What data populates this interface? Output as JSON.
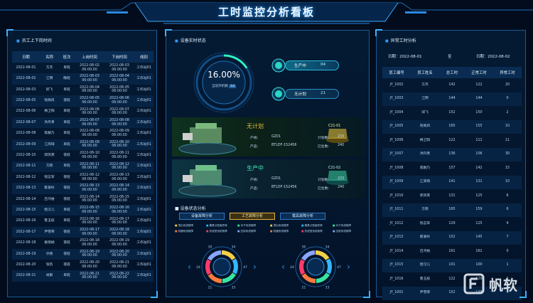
{
  "header": {
    "title": "工时监控分析看板"
  },
  "left": {
    "title": "员工上下岗时间",
    "columns": [
      "日期",
      "名称",
      "班次",
      "上岗时间",
      "下岗时间",
      "线别"
    ],
    "rows": [
      [
        "2022-08-01",
        "方杰",
        "早班",
        "2022-08-02 06:00:00",
        "2022-08-03 06:00:00",
        "工作站01"
      ],
      [
        "2022-08-02",
        "江明",
        "晚班",
        "2022-08-03 06:00:00",
        "2022-08-04 06:00:00",
        "工作站01"
      ],
      [
        "2022-08-03",
        "邱飞",
        "早班",
        "2022-08-04 06:00:00",
        "2022-08-05 06:00:00",
        "工作站01"
      ],
      [
        "2022-08-05",
        "钱佩凤",
        "夜班",
        "2022-08-05 06:00:00",
        "2022-08-06 06:00:00",
        "工作站01"
      ],
      [
        "2022-08-06",
        "梅卫阳",
        "早班",
        "2022-08-06 06:00:00",
        "2022-08-07 06:00:00",
        "工作站01"
      ],
      [
        "2022-08-07",
        "洪丹青",
        "早班",
        "2022-08-07 06:00:00",
        "2022-08-08 06:00:00",
        "工作站01"
      ],
      [
        "2022-08-08",
        "蒋群乃",
        "早班",
        "2022-08-08 06:00:00",
        "2022-08-09 06:00:00",
        "工作站01"
      ],
      [
        "2022-08-09",
        "江简琦",
        "早班",
        "2022-08-09 06:00:00",
        "2022-08-10 06:00:00",
        "工作站01"
      ],
      [
        "2022-08-10",
        "郭凤英",
        "夜班",
        "2022-08-10 06:00:00",
        "2022-08-11 06:00:00",
        "工作站01"
      ],
      [
        "2022-08-11",
        "方晓",
        "早班",
        "2022-08-11 06:00:00",
        "2022-08-12 06:00:00",
        "工作站01"
      ],
      [
        "2022-08-12",
        "钱志军",
        "夜班",
        "2022-08-12 06:00:00",
        "2022-08-13 06:00:00",
        "工作站01"
      ],
      [
        "2022-08-13",
        "蔡爱岭",
        "夜班",
        "2022-08-13 06:00:00",
        "2022-08-14 06:00:00",
        "工作站01"
      ],
      [
        "2022-08-14",
        "吕鸿裕",
        "夜班",
        "2022-08-14 06:00:00",
        "2022-08-15 06:00:00",
        "工作站01"
      ],
      [
        "2022-08-15",
        "程汉儿",
        "早班",
        "2022-08-15 06:00:00",
        "2022-08-16 06:00:00",
        "工作站01"
      ],
      [
        "2022-08-16",
        "鲁玉枝",
        "早班",
        "2022-08-16 06:00:00",
        "2022-08-17 06:00:00",
        "工作站01"
      ],
      [
        "2022-08-17",
        "尹雪荣",
        "夜班",
        "2022-08-17 06:00:00",
        "2022-08-18 06:00:00",
        "工作站01"
      ],
      [
        "2022-08-18",
        "秦丽娟",
        "夜班",
        "2022-08-18 06:00:00",
        "2022-08-19 06:00:00",
        "工作站01"
      ],
      [
        "2022-08-19",
        "许杨",
        "夜班",
        "2022-08-19 06:00:00",
        "2022-08-20 06:00:00",
        "工作站01"
      ],
      [
        "2022-08-20",
        "张凯",
        "夜班",
        "2022-08-20 06:00:00",
        "2022-08-21 06:00:00",
        "工作站01"
      ],
      [
        "2022-08-21",
        "尚毅",
        "早班",
        "2022-08-21 06:00:00",
        "2022-08-22 06:00:00",
        "工作站01"
      ]
    ]
  },
  "middle": {
    "title": "设备实时状态",
    "gauge": {
      "value": "16.00%",
      "label": "当前开机数",
      "count": "04",
      "fraction": 0.16
    },
    "pill1": {
      "label": "生产中",
      "value": "04"
    },
    "pill2": {
      "label": "无计划",
      "value": "21"
    },
    "devices": [
      {
        "status": "无计划",
        "code": "C21-01",
        "k1": "产线:",
        "v1": "GZ01",
        "k2": "计划数:",
        "v2": "233",
        "k3": "产品:",
        "v3": "BTLDF-152456",
        "k4": "已生数:",
        "v4": "240",
        "color": "#e0bb3a"
      },
      {
        "status": "生产中",
        "code": "C21-02",
        "k1": "产线:",
        "v1": "GZ01",
        "k2": "计划数:",
        "v2": "233",
        "k3": "产品:",
        "v3": "BTLDF-152456",
        "k4": "已生数:",
        "v4": "240",
        "color": "#3fe3b0"
      }
    ],
    "analysis_title": "设备状态分析",
    "tabs": [
      "设备故障分析",
      "工艺故障分析",
      "模具故障分析"
    ],
    "legend_groups": [
      [
        "顶出系统故障",
        "模具分型面异常",
        "冲子系统故障",
        "机器系统故障",
        "热成型系统故障",
        "压射系统故障"
      ],
      [
        "顶出系统故障",
        "模具分型面异常",
        "冲子系统故障",
        "机器系统故障",
        "热成型系统故障",
        "压射系统故障"
      ]
    ],
    "legend_colors": [
      "#f3d046",
      "#34b6ff",
      "#37e6a2",
      "#ff7a3d",
      "#ff3b6b",
      "#8aa6ff"
    ],
    "donuts": [
      {
        "labels": [
          "34",
          "47",
          "33",
          "21",
          "24",
          "30"
        ]
      },
      {
        "labels": [
          "34",
          "47",
          "33",
          "21",
          "24",
          "30"
        ]
      }
    ]
  },
  "right": {
    "title": "异常工时分析",
    "date_from": "日期：2022-08-01",
    "to": "至",
    "date_to": "日期：2022-08-02",
    "columns": [
      "员工编号",
      "员工姓名",
      "总工时",
      "正常工时",
      "异常工时"
    ],
    "rows": [
      [
        "JY_1002",
        "方杰",
        "142",
        "122",
        "20"
      ],
      [
        "JY_1003",
        "江明",
        "144",
        "144",
        "0"
      ],
      [
        "JY_1004",
        "邱飞",
        "152",
        "150",
        "2"
      ],
      [
        "JY_1005",
        "钱佩凤",
        "165",
        "155",
        "10"
      ],
      [
        "JY_1006",
        "梅卫阳",
        "122",
        "111",
        "11"
      ],
      [
        "JY_1007",
        "洪丹青",
        "136",
        "106",
        "30"
      ],
      [
        "JY_1008",
        "蒋群乃",
        "157",
        "142",
        "15"
      ],
      [
        "JY_1009",
        "江简琦",
        "141",
        "131",
        "10"
      ],
      [
        "JY_1010",
        "郭凤英",
        "131",
        "125",
        "6"
      ],
      [
        "JY_1011",
        "方晓",
        "165",
        "159",
        "6"
      ],
      [
        "JY_1012",
        "钱志军",
        "129",
        "125",
        "4"
      ],
      [
        "JY_1013",
        "蔡爱岭",
        "152",
        "145",
        "7"
      ],
      [
        "JY_1014",
        "吕鸿裕",
        "161",
        "161",
        "0"
      ],
      [
        "JY_1015",
        "程汉儿",
        "101",
        "100",
        "1"
      ],
      [
        "JY_1016",
        "鲁玉枝",
        "122",
        "120",
        "2"
      ],
      [
        "JY_1001",
        "尹雪荣",
        "152",
        "148",
        "4"
      ]
    ]
  },
  "brand": {
    "text": "帆软"
  }
}
